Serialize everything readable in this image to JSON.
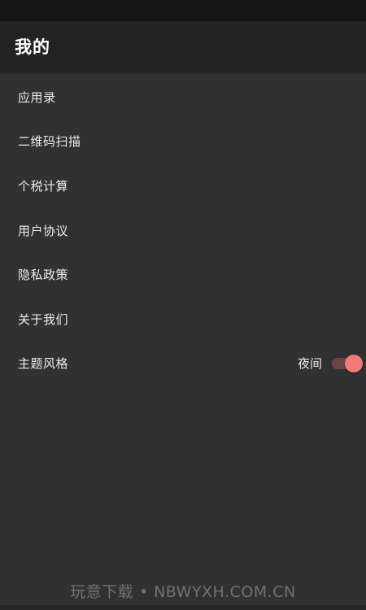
{
  "app_bar": {
    "title": "我的"
  },
  "menu": {
    "items": [
      {
        "label": "应用录"
      },
      {
        "label": "二维码扫描"
      },
      {
        "label": "个税计算"
      },
      {
        "label": "用户协议"
      },
      {
        "label": "隐私政策"
      },
      {
        "label": "关于我们"
      }
    ],
    "theme": {
      "label": "主题风格",
      "mode_label": "夜间",
      "toggle_on": true
    }
  },
  "watermark": {
    "text": "玩意下载 • NBWYXH.COM.CN"
  },
  "colors": {
    "background": "#313131",
    "app_bar": "#222222",
    "status_bar": "#141414",
    "toggle_thumb": "#f07a78",
    "toggle_track": "#6a4646",
    "text": "#ececec"
  }
}
